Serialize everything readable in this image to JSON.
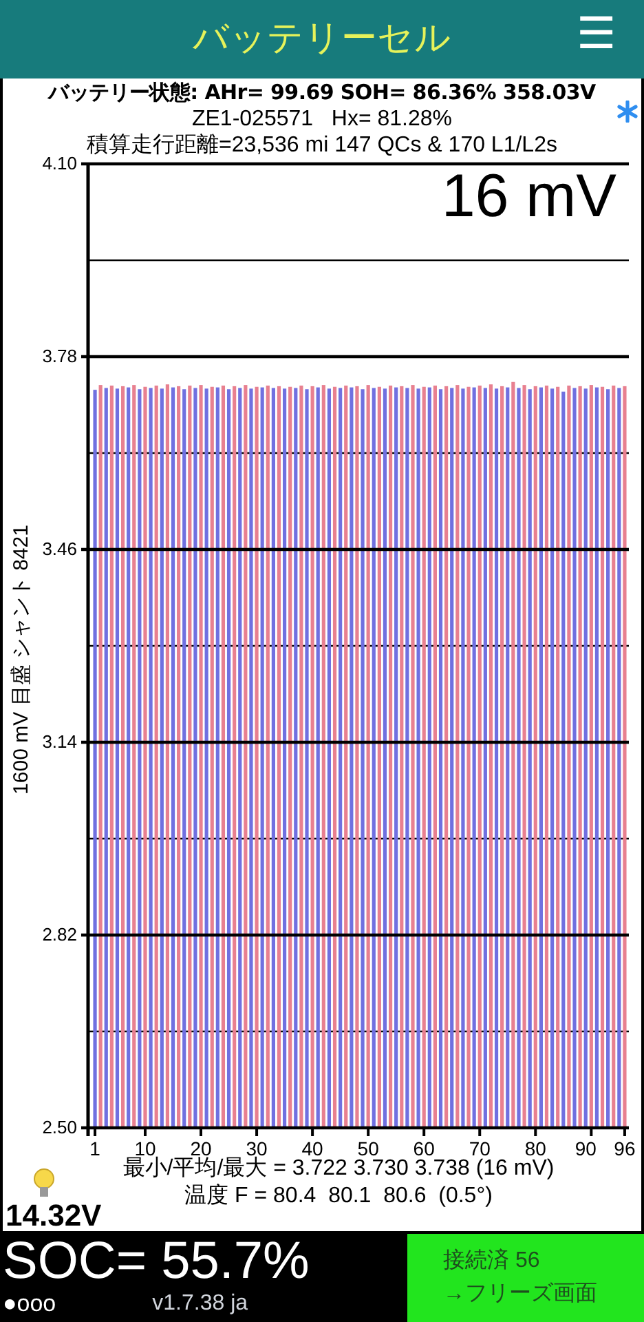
{
  "header": {
    "title": "バッテリーセル",
    "menu_icon": "☰"
  },
  "status": {
    "line_1": "バッテリー状態: AHr= 99.69 SOH= 86.36% 358.03V",
    "line_2": "ZE1-025571   Hx= 81.28%",
    "line_3": "積算走行距離=23,536 mi 147 QCs & 170 L1/L2s"
  },
  "chart_overlay": {
    "spread": "16 mV"
  },
  "chart_data": {
    "type": "bar",
    "ylabel": "1600 mV 目盛   シャント 8421",
    "grid": true,
    "ylim": [
      2.5,
      4.1
    ],
    "xlim": [
      0.5,
      96.5
    ],
    "yticks": [
      {
        "value": 4.1,
        "label": "4.10"
      },
      {
        "value": 3.78,
        "label": "3.78"
      },
      {
        "value": 3.46,
        "label": "3.46"
      },
      {
        "value": 3.14,
        "label": "3.14"
      },
      {
        "value": 2.82,
        "label": "2.82"
      },
      {
        "value": 2.5,
        "label": "2.50"
      }
    ],
    "xticks": [
      1,
      10,
      20,
      30,
      40,
      50,
      60,
      70,
      80,
      90,
      96
    ],
    "x": [
      1,
      2,
      3,
      4,
      5,
      6,
      7,
      8,
      9,
      10,
      11,
      12,
      13,
      14,
      15,
      16,
      17,
      18,
      19,
      20,
      21,
      22,
      23,
      24,
      25,
      26,
      27,
      28,
      29,
      30,
      31,
      32,
      33,
      34,
      35,
      36,
      37,
      38,
      39,
      40,
      41,
      42,
      43,
      44,
      45,
      46,
      47,
      48,
      49,
      50,
      51,
      52,
      53,
      54,
      55,
      56,
      57,
      58,
      59,
      60,
      61,
      62,
      63,
      64,
      65,
      66,
      67,
      68,
      69,
      70,
      71,
      72,
      73,
      74,
      75,
      76,
      77,
      78,
      79,
      80,
      81,
      82,
      83,
      84,
      85,
      86,
      87,
      88,
      89,
      90,
      91,
      92,
      93,
      94,
      95,
      96
    ],
    "series": [
      {
        "color": "#7070e0",
        "values": [
          3.725,
          null,
          3.728,
          null,
          3.727,
          null,
          3.729,
          null,
          3.726,
          null,
          3.728,
          null,
          3.727,
          null,
          3.729,
          null,
          3.726,
          null,
          3.728,
          null,
          3.727,
          null,
          3.729,
          null,
          3.726,
          null,
          3.728,
          null,
          3.727,
          null,
          3.729,
          null,
          3.728,
          null,
          3.727,
          null,
          3.728,
          null,
          3.726,
          null,
          3.729,
          null,
          3.727,
          null,
          3.728,
          null,
          3.729,
          null,
          3.726,
          null,
          3.728,
          null,
          3.727,
          null,
          3.729,
          null,
          3.728,
          null,
          3.727,
          null,
          3.729,
          null,
          3.726,
          null,
          3.728,
          null,
          3.727,
          null,
          3.729,
          null,
          3.728,
          null,
          3.727,
          null,
          3.729,
          null,
          3.728,
          null,
          3.726,
          null,
          3.729,
          null,
          3.727,
          null,
          3.722,
          null,
          3.728,
          null,
          3.727,
          null,
          3.729,
          null,
          3.726,
          null,
          3.728,
          null
        ]
      },
      {
        "color": "#e88090",
        "values": [
          null,
          3.733,
          null,
          3.732,
          null,
          3.731,
          null,
          3.733,
          null,
          3.73,
          null,
          3.732,
          null,
          3.734,
          null,
          3.731,
          null,
          3.732,
          null,
          3.733,
          null,
          3.73,
          null,
          3.732,
          null,
          3.731,
          null,
          3.733,
          null,
          3.73,
          null,
          3.732,
          null,
          3.731,
          null,
          3.73,
          null,
          3.732,
          null,
          3.731,
          null,
          3.733,
          null,
          3.73,
          null,
          3.732,
          null,
          3.731,
          null,
          3.733,
          null,
          3.73,
          null,
          3.732,
          null,
          3.731,
          null,
          3.733,
          null,
          3.73,
          null,
          3.732,
          null,
          3.731,
          null,
          3.733,
          null,
          3.73,
          null,
          3.732,
          null,
          3.734,
          null,
          3.731,
          null,
          3.738,
          null,
          3.733,
          null,
          3.731,
          null,
          3.732,
          null,
          3.73,
          null,
          3.732,
          null,
          3.731,
          null,
          3.733,
          null,
          3.73,
          null,
          3.732,
          null,
          3.731
        ]
      }
    ]
  },
  "summary": {
    "min_avg_max": "最小/平均/最大 = 3.722 3.730 3.738  (16 mV)",
    "temperature": "温度 F = 80.4  80.1  80.6  (0.5°)",
    "aux_voltage": "14.32V"
  },
  "footer": {
    "soc": "SOC= 55.7%",
    "page_dots": "●ooo",
    "version": "v1.7.38 ja",
    "connection": "接続済 56",
    "freeze_button": "→フリーズ画面"
  }
}
